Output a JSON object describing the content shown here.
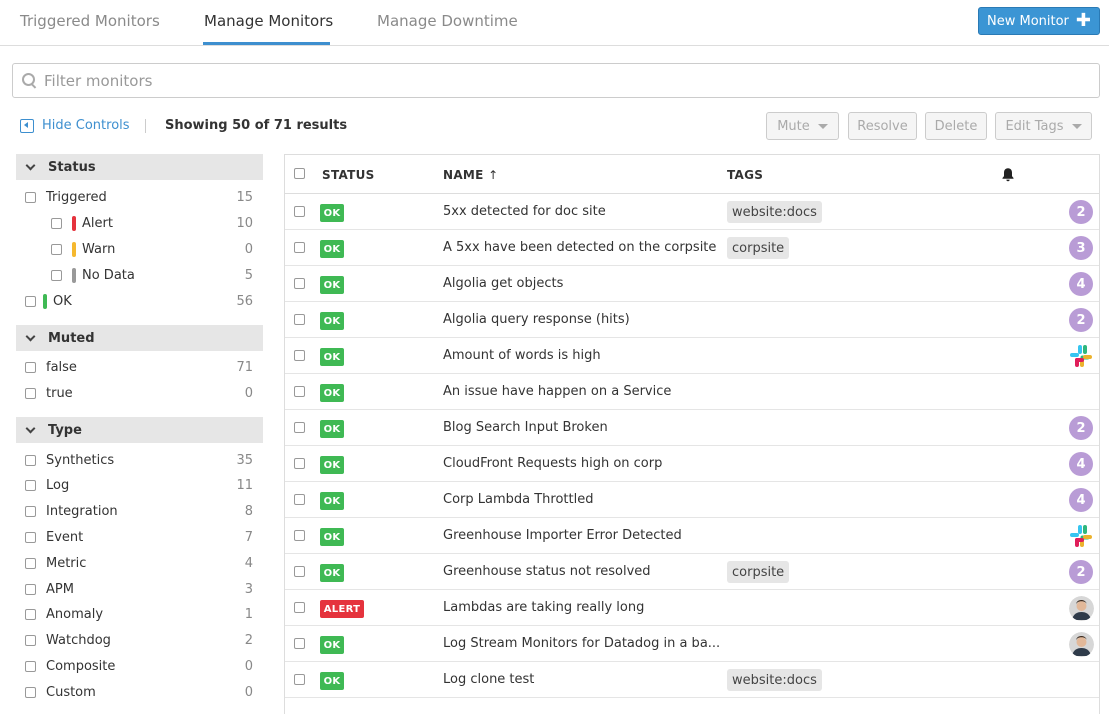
{
  "tabs": [
    {
      "label": "Triggered Monitors"
    },
    {
      "label": "Manage Monitors"
    },
    {
      "label": "Manage Downtime"
    }
  ],
  "new_monitor_label": "New Monitor",
  "search": {
    "placeholder": "Filter monitors",
    "value": ""
  },
  "controls": {
    "hide_label": "Hide Controls",
    "showing": "Showing 50 of 71 results",
    "mute": "Mute",
    "resolve": "Resolve",
    "delete": "Delete",
    "edit_tags": "Edit Tags"
  },
  "facets": {
    "status": {
      "title": "Status",
      "items": [
        {
          "label": "Triggered",
          "count": "15"
        },
        {
          "label": "Alert",
          "count": "10",
          "color": "#e5333d"
        },
        {
          "label": "Warn",
          "count": "0",
          "color": "#f5b82e"
        },
        {
          "label": "No Data",
          "count": "5",
          "color": "#999999"
        },
        {
          "label": "OK",
          "count": "56",
          "color": "#3fb954"
        }
      ]
    },
    "muted": {
      "title": "Muted",
      "items": [
        {
          "label": "false",
          "count": "71"
        },
        {
          "label": "true",
          "count": "0"
        }
      ]
    },
    "type": {
      "title": "Type",
      "items": [
        {
          "label": "Synthetics",
          "count": "35"
        },
        {
          "label": "Log",
          "count": "11"
        },
        {
          "label": "Integration",
          "count": "8"
        },
        {
          "label": "Event",
          "count": "7"
        },
        {
          "label": "Metric",
          "count": "4"
        },
        {
          "label": "APM",
          "count": "3"
        },
        {
          "label": "Anomaly",
          "count": "1"
        },
        {
          "label": "Watchdog",
          "count": "2"
        },
        {
          "label": "Composite",
          "count": "0"
        },
        {
          "label": "Custom",
          "count": "0"
        }
      ]
    }
  },
  "table": {
    "headers": {
      "status": "STATUS",
      "name": "NAME",
      "sort_indicator": "↑",
      "tags": "TAGS"
    },
    "rows": [
      {
        "status": "OK",
        "name": "5xx detected for doc site",
        "tag": "website:docs",
        "notify": "2"
      },
      {
        "status": "OK",
        "name": "A 5xx have been detected on the corpsite",
        "tag": "corpsite",
        "notify": "3"
      },
      {
        "status": "OK",
        "name": "Algolia get objects",
        "tag": "",
        "notify": "4"
      },
      {
        "status": "OK",
        "name": "Algolia query response (hits)",
        "tag": "",
        "notify": "2"
      },
      {
        "status": "OK",
        "name": "Amount of words is high",
        "tag": "",
        "notify_icon": "slack-icon"
      },
      {
        "status": "OK",
        "name": "An issue have happen on a Service",
        "tag": ""
      },
      {
        "status": "OK",
        "name": "Blog Search Input Broken",
        "tag": "",
        "notify": "2"
      },
      {
        "status": "OK",
        "name": "CloudFront Requests high on corp",
        "tag": "",
        "notify": "4"
      },
      {
        "status": "OK",
        "name": "Corp Lambda Throttled",
        "tag": "",
        "notify": "4"
      },
      {
        "status": "OK",
        "name": "Greenhouse Importer Error Detected",
        "tag": "",
        "notify_icon": "slack-icon"
      },
      {
        "status": "OK",
        "name": "Greenhouse status not resolved",
        "tag": "corpsite",
        "notify": "2"
      },
      {
        "status": "ALERT",
        "name": "Lambdas are taking really long",
        "tag": "",
        "notify_icon": "user-avatar"
      },
      {
        "status": "OK",
        "name": "Log Stream Monitors for Datadog in a ba...",
        "tag": "",
        "notify_icon": "user-avatar"
      },
      {
        "status": "OK",
        "name": "Log clone test",
        "tag": "website:docs"
      }
    ]
  }
}
